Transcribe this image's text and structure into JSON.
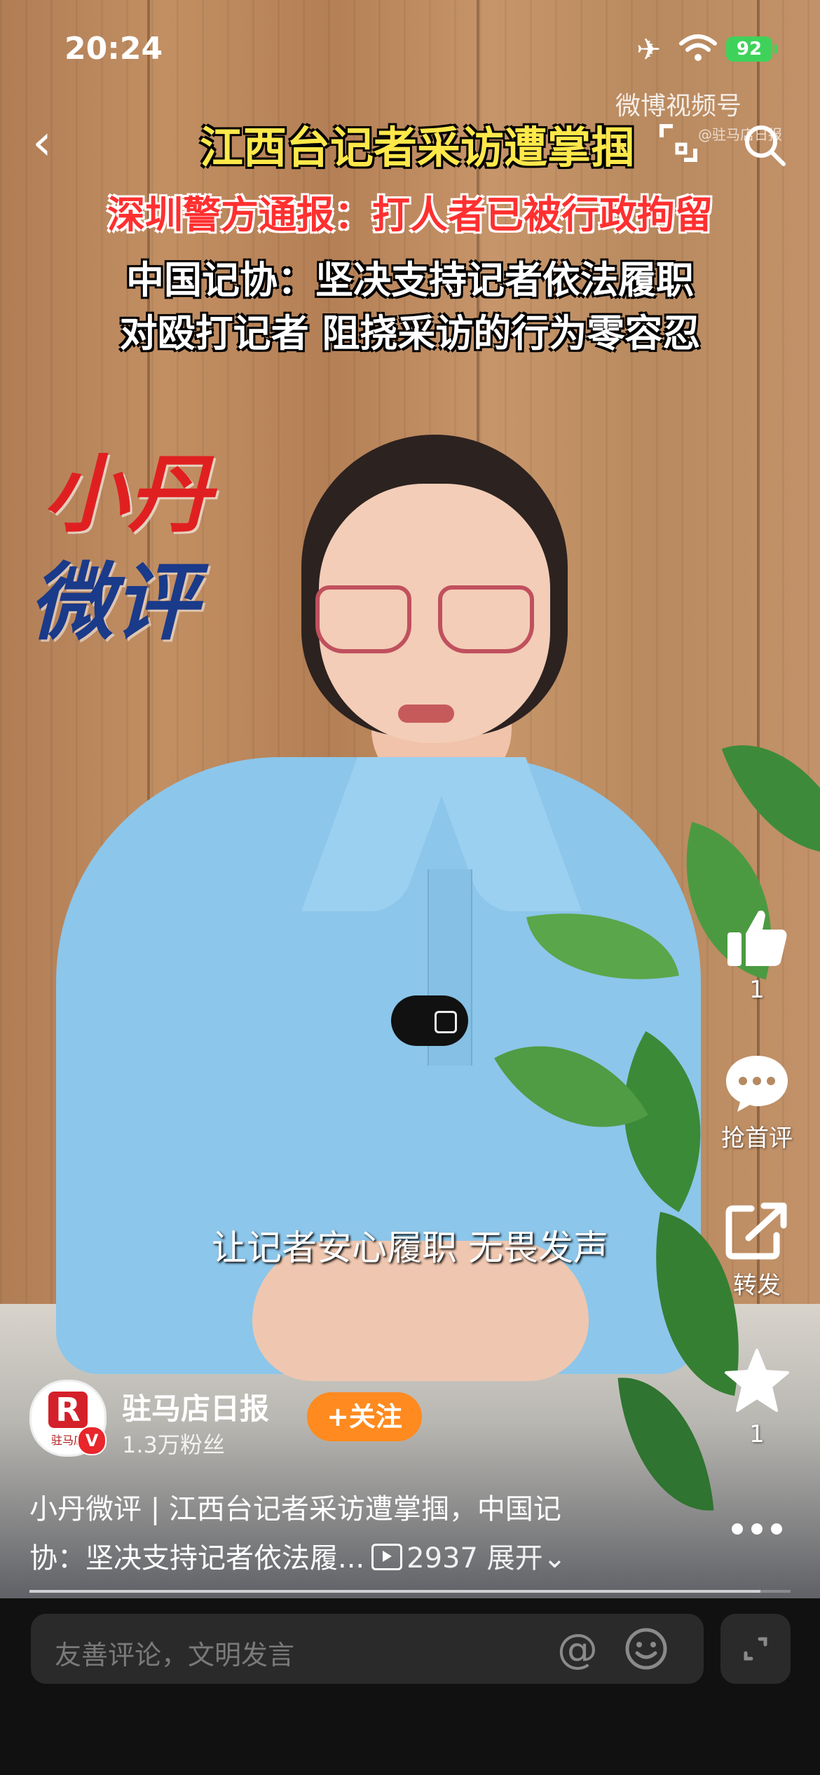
{
  "status_bar": {
    "time": "20:24",
    "battery": "92"
  },
  "watermark": {
    "brand": "微博视频号",
    "handle": "@驻马店日报"
  },
  "overlay": {
    "headline": "江西台记者采访遭掌掴",
    "police_notice": "深圳警方通报：打人者已被行政拘留",
    "statement_line1": "中国记协：坚决支持记者依法履职",
    "statement_line2": "对殴打记者 阻挠采访的行为零容忍",
    "brand_line1": "小丹",
    "brand_line2": "微评",
    "subtitle": "让记者安心履职 无畏发声"
  },
  "actions": {
    "like_count": "1",
    "comment_label": "抢首评",
    "share_label": "转发",
    "favorite_count": "1",
    "more_icon": "more-icon"
  },
  "author": {
    "name": "驻马店日报",
    "fans": "1.3万粉丝",
    "follow_label": "+关注",
    "avatar_logo_text": "驻马店"
  },
  "description": {
    "line1": "小丹微评 | 江西台记者采访遭掌掴，中国记",
    "line2": "协：坚决支持记者依法履...",
    "play_count": "2937",
    "expand_label": "展开"
  },
  "playback": {
    "progress_fraction": 0.96
  },
  "comment_bar": {
    "placeholder": "友善评论，文明发言"
  },
  "colors": {
    "follow": "#ff8a1f",
    "headline": "#ffe84a",
    "notice": "#ff3030",
    "battery": "#3fd25a"
  }
}
